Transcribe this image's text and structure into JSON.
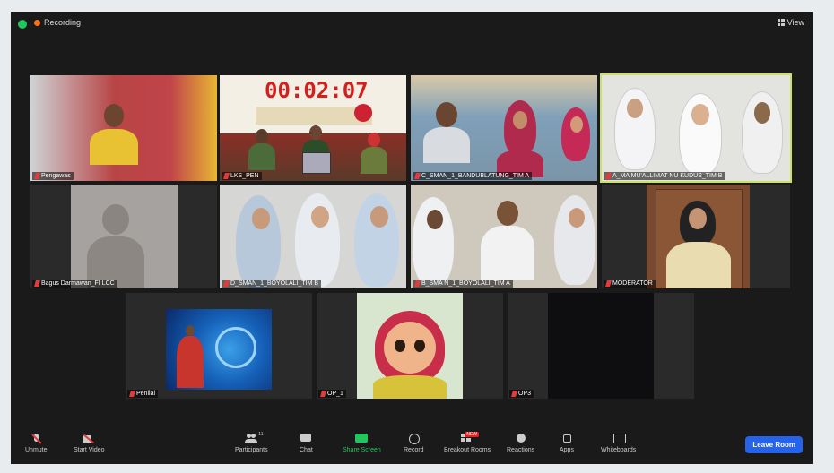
{
  "topbar": {
    "recording": "Recording",
    "view": "View"
  },
  "timer": "00:02:07",
  "participants": [
    {
      "name": "Pengawas"
    },
    {
      "name": "LKS_PEN"
    },
    {
      "name": "C_SMAN_1_BANDUBLATUNG_TIM A"
    },
    {
      "name": "A_MA MU'ALLIMAT NU KUDUS_TIM B"
    },
    {
      "name": "Bagus Darmawan_FI LCC"
    },
    {
      "name": "D_SMAN_1_BOYOLALI_TIM B"
    },
    {
      "name": "B_SMA N_1_BOYOLALI_TIM A"
    },
    {
      "name": "MODERATOR"
    },
    {
      "name": "Penilai"
    },
    {
      "name": "OP_1"
    },
    {
      "name": "OP3"
    }
  ],
  "toolbar": {
    "unmute": "Unmute",
    "start_video": "Start Video",
    "participants": "Participants",
    "participants_count": "11",
    "chat": "Chat",
    "share_screen": "Share Screen",
    "record": "Record",
    "breakout_rooms": "Breakout Rooms",
    "reactions": "Reactions",
    "apps": "Apps",
    "whiteboards": "Whiteboards",
    "leave": "Leave Room"
  },
  "colors": {
    "accent": "#22c55e",
    "leave": "#2563eb",
    "speaker_border": "#c9e265",
    "timer": "#d41f1f"
  }
}
